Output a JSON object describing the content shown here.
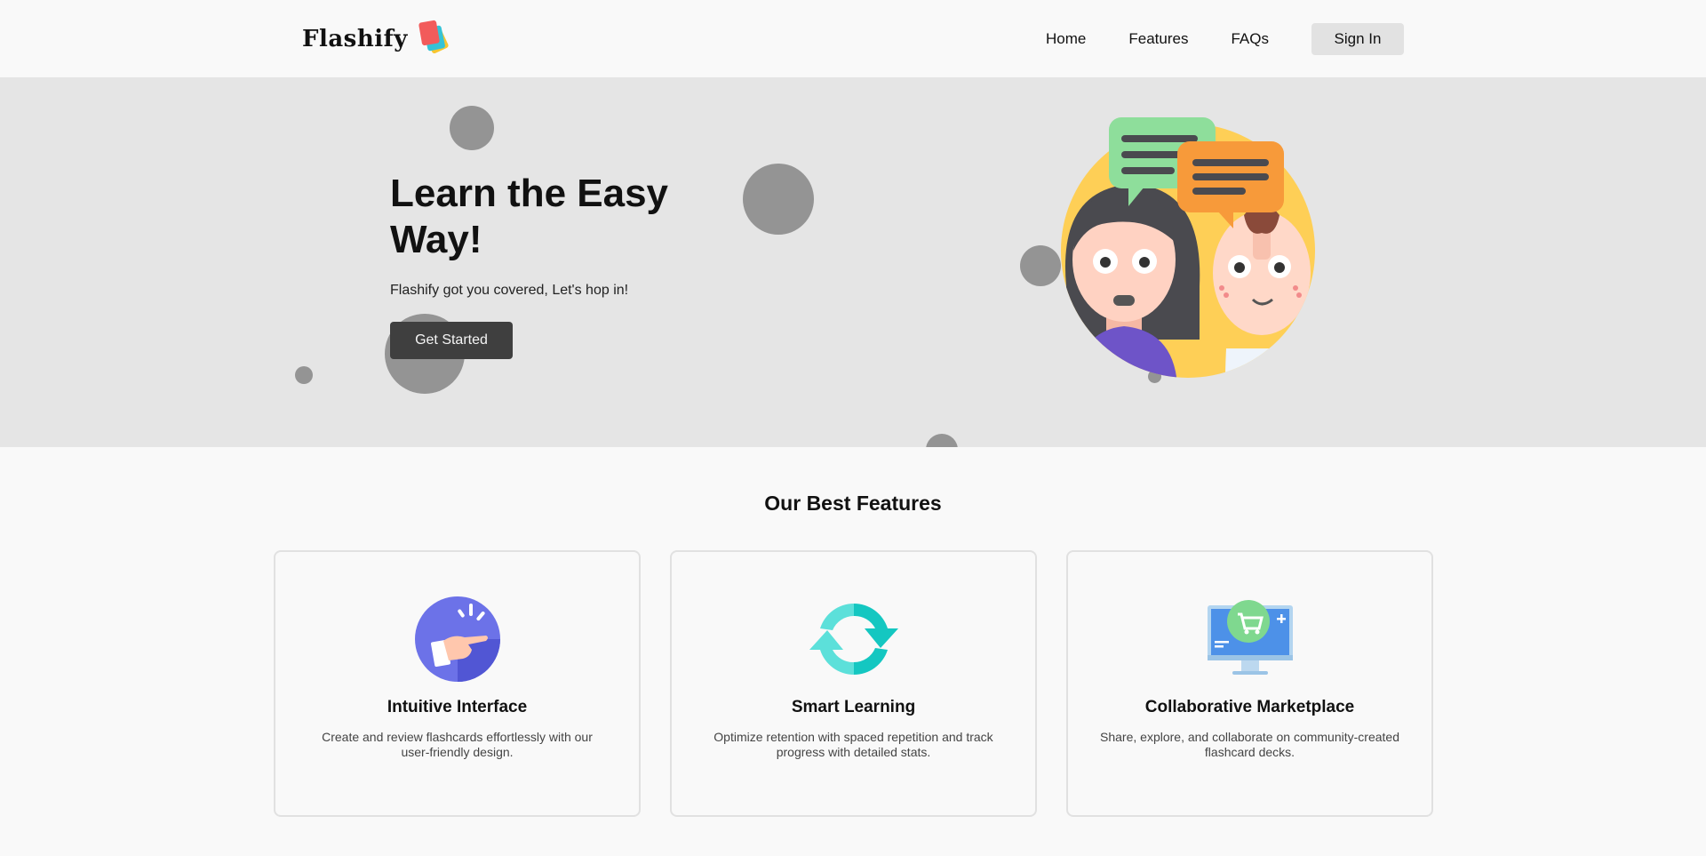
{
  "brand": {
    "name": "Flashify"
  },
  "nav": {
    "items": [
      {
        "label": "Home"
      },
      {
        "label": "Features"
      },
      {
        "label": "FAQs"
      }
    ],
    "signin_label": "Sign In"
  },
  "hero": {
    "title": "Learn the Easy Way!",
    "subtitle": "Flashify got you covered, Let's hop in!",
    "cta_label": "Get Started",
    "illustration_icon": "two-people-chatting-illustration"
  },
  "features": {
    "title": "Our Best Features",
    "cards": [
      {
        "title": "Intuitive Interface",
        "desc": "Create and review flashcards effortlessly with our user-friendly design.",
        "icon": "tap-hand-icon"
      },
      {
        "title": "Smart Learning",
        "desc": "Optimize retention with spaced repetition and track progress with detailed stats.",
        "icon": "refresh-cycle-icon"
      },
      {
        "title": "Collaborative Marketplace",
        "desc": "Share, explore, and collaborate on community-created flashcard decks.",
        "icon": "marketplace-monitor-icon"
      }
    ]
  },
  "colors": {
    "page_bg": "#f9f9f9",
    "hero_bg": "#e5e5e5",
    "bubble": "#949494",
    "cta_bg": "#3f3f3f",
    "signin_bg": "#e2e2e2"
  }
}
